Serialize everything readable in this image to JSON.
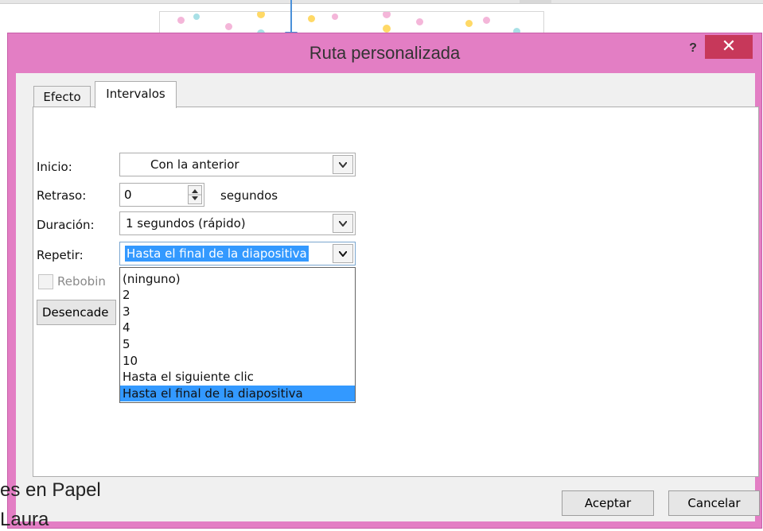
{
  "background": {
    "text_line1": "es en Papel",
    "text_line2": "Laura"
  },
  "dialog": {
    "title": "Ruta personalizada",
    "help_label": "?",
    "close_label": "✕"
  },
  "tabs": [
    {
      "label": "Efecto",
      "active": false
    },
    {
      "label": "Intervalos",
      "active": true
    }
  ],
  "form": {
    "inicio_label": "Inicio:",
    "inicio_value": "Con la anterior",
    "retraso_label": "Retraso:",
    "retraso_value": "0",
    "retraso_unit": "segundos",
    "duracion_label": "Duración:",
    "duracion_value": "1 segundos (rápido)",
    "repetir_label": "Repetir:",
    "repetir_value": "Hasta el final de la diapositiva",
    "rebobinar_label": "Rebobin",
    "desencadenadores_label": "Desencade"
  },
  "repetir_options": [
    "(ninguno)",
    "2",
    "3",
    "4",
    "5",
    "10",
    "Hasta el siguiente clic",
    "Hasta el final de la diapositiva"
  ],
  "repetir_selected_index": 7,
  "buttons": {
    "aceptar": "Aceptar",
    "cancelar": "Cancelar"
  },
  "colors": {
    "dialog_frame": "#e37ec4",
    "close_button": "#c7385a",
    "selection": "#3399ff",
    "motion_path": "#4a90d9"
  }
}
